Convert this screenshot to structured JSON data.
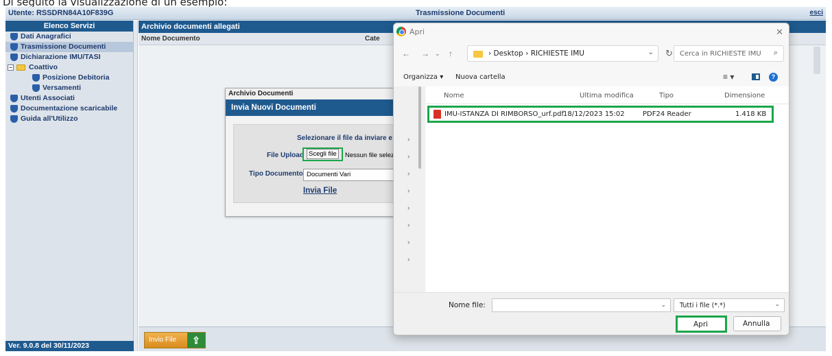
{
  "caption": "Di seguito la visualizzazione di un esempio:",
  "topbar": {
    "user": "Utente: RSSDRN84A10F839G",
    "title": "Trasmissione Documenti",
    "logout": "esci"
  },
  "sidebar": {
    "header": "Elenco Servizi",
    "items": [
      {
        "label": "Dati Anagrafici"
      },
      {
        "label": "Trasmissione Documenti"
      },
      {
        "label": "Dichiarazione IMU/TASI"
      },
      {
        "label": "Coattivo",
        "toggle": "−"
      },
      {
        "label": "Posizione Debitoria"
      },
      {
        "label": "Versamenti"
      },
      {
        "label": "Utenti Associati"
      },
      {
        "label": "Documentazione scaricabile"
      },
      {
        "label": "Guida all'Utilizzo"
      }
    ],
    "version": "Ver. 9.0.8 del 30/11/2023"
  },
  "main": {
    "header": "Archivio documenti allegati",
    "columns": [
      "Nome Documento",
      "Cate"
    ],
    "footer_button": "Invio File",
    "footer_icon": "upload-icon"
  },
  "modal": {
    "window_title": "Archivio Documenti",
    "header": "Invia Nuovi Documenti",
    "hint": "Selezionare il file da inviare e pren",
    "file_upload_label": "File Upload",
    "choose_file": "Scegli file",
    "no_file": "Nessun file selezion",
    "doc_type_label": "Tipo Documento",
    "doc_type_value": "Documenti Vari",
    "send_link": "Invia File"
  },
  "dialog": {
    "title": "Apri",
    "address": {
      "crumbs": [
        "Desktop",
        "RICHIESTE IMU"
      ]
    },
    "search_placeholder": "Cerca in RICHIESTE IMU",
    "organize": "Organizza ▾",
    "new_folder": "Nuova cartella",
    "columns": [
      "Nome",
      "Ultima modifica",
      "Tipo",
      "Dimensione"
    ],
    "files": [
      {
        "name": "IMU-ISTANZA DI RIMBORSO_urf.pdf",
        "modified": "18/12/2023 15:02",
        "type": "PDF24 Reader",
        "size": "1.418 KB"
      }
    ],
    "filename_label": "Nome file:",
    "filename_value": "",
    "filter": "Tutti i file (*.*)",
    "open_button": "Apri",
    "cancel_button": "Annulla"
  },
  "colors": {
    "accent": "#1f5a8f",
    "highlight": "#1aa64a",
    "button_orange": "#d98b1c"
  }
}
